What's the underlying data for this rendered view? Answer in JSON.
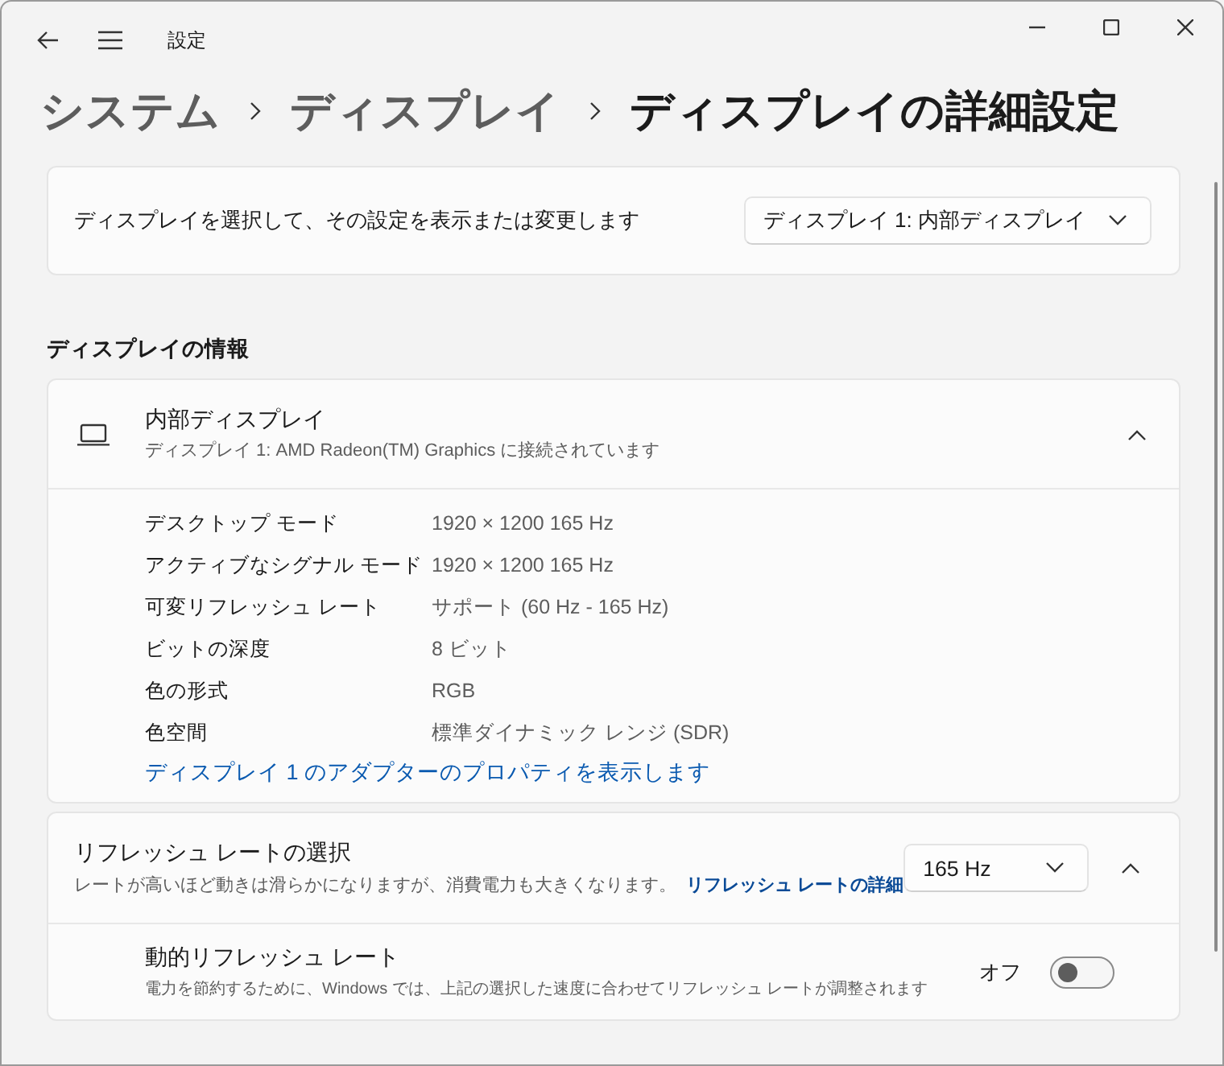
{
  "window": {
    "title": "設定"
  },
  "breadcrumb": [
    {
      "label": "システム",
      "current": false
    },
    {
      "label": "ディスプレイ",
      "current": false
    },
    {
      "label": "ディスプレイの詳細設定",
      "current": true
    }
  ],
  "display_select": {
    "label": "ディスプレイを選択して、その設定を表示または変更します",
    "dropdown": {
      "value": "ディスプレイ 1: 内部ディスプレイ"
    }
  },
  "section_heading": "ディスプレイの情報",
  "display_info": {
    "title": "内部ディスプレイ",
    "subtitle": "ディスプレイ 1: AMD Radeon(TM) Graphics に接続されています",
    "expanded": true,
    "properties": [
      {
        "name": "デスクトップ モード",
        "value": "1920 × 1200 165 Hz"
      },
      {
        "name": "アクティブなシグナル モード",
        "value": "1920 × 1200 165 Hz"
      },
      {
        "name": "可変リフレッシュ レート",
        "value": "サポート (60 Hz - 165 Hz)"
      },
      {
        "name": "ビットの深度",
        "value": "8 ビット"
      },
      {
        "name": "色の形式",
        "value": "RGB"
      },
      {
        "name": "色空間",
        "value": "標準ダイナミック レンジ (SDR)"
      }
    ],
    "link": "ディスプレイ 1 のアダプターのプロパティを表示します"
  },
  "refresh_rate": {
    "title": "リフレッシュ レートの選択",
    "description": "レートが高いほど動きは滑らかになりますが、消費電力も大きくなります。",
    "link": "リフレッシュ レートの詳細",
    "dropdown": {
      "value": "165 Hz"
    },
    "expanded": true,
    "dynamic": {
      "title": "動的リフレッシュ レート",
      "description": "電力を節約するために、Windows では、上記の選択した速度に合わせてリフレッシュ レートが調整されます",
      "state_label": "オフ",
      "on": false
    }
  }
}
